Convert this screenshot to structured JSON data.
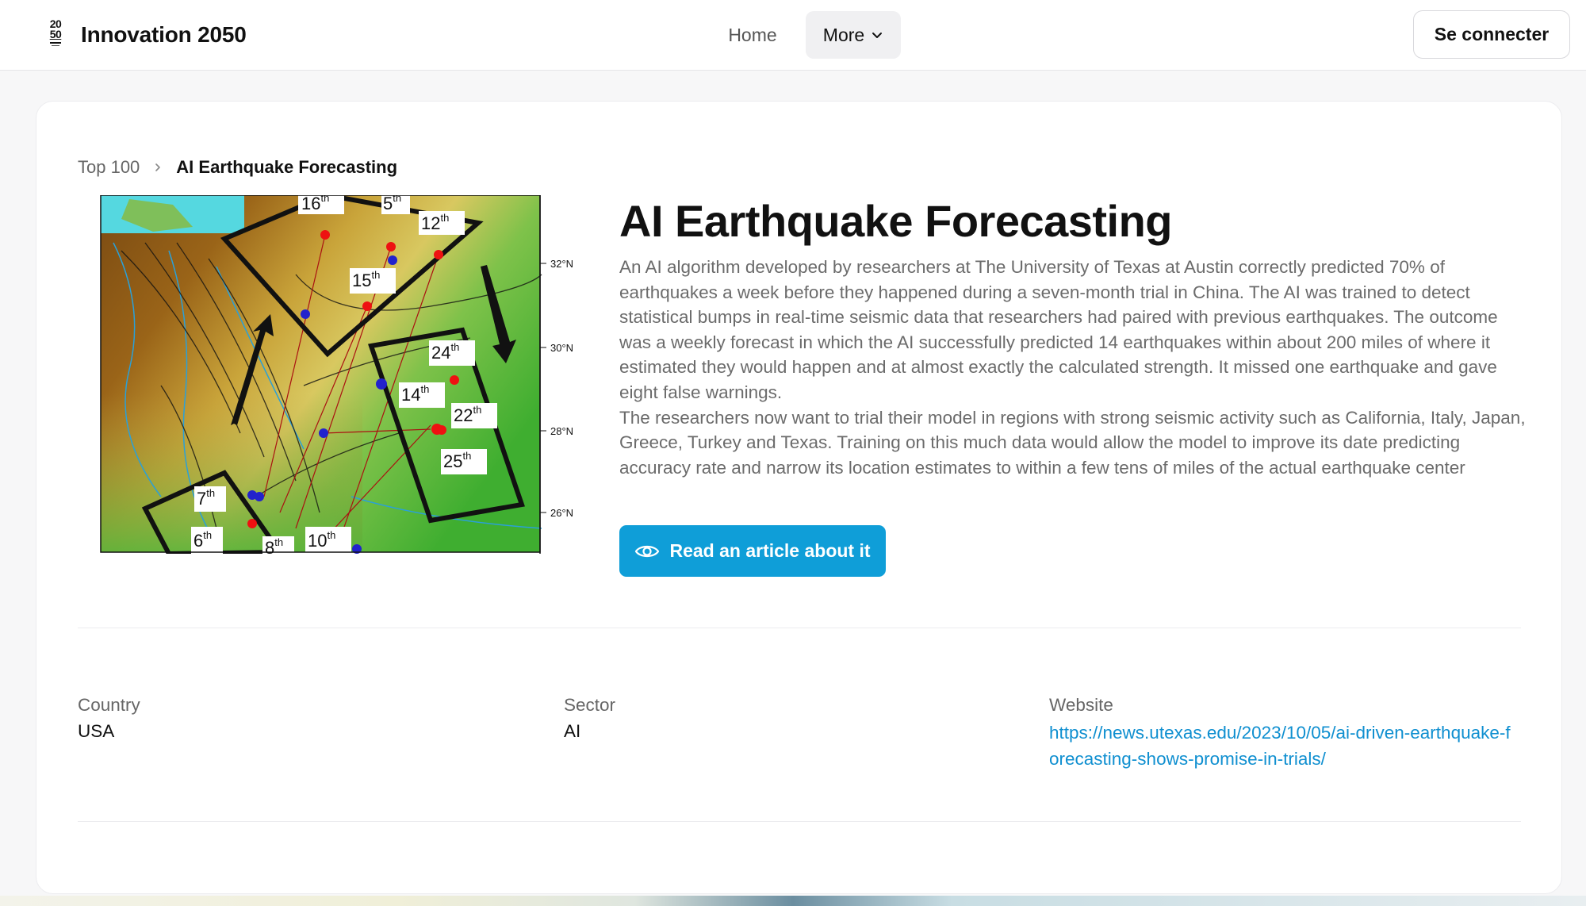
{
  "header": {
    "logo_top": "20",
    "logo_bottom": "50",
    "brand": "Innovation 2050",
    "nav_home": "Home",
    "nav_more": "More",
    "signin": "Se connecter"
  },
  "breadcrumb": {
    "parent": "Top 100",
    "current": "AI Earthquake Forecasting"
  },
  "article": {
    "title": "AI Earthquake Forecasting",
    "paragraph1": "An AI algorithm developed by researchers at The University of Texas at Austin correctly predicted 70% of earthquakes a week before they happened during a seven-month trial in China. The AI was trained to detect statistical bumps in real-time seismic data that researchers had paired with previous earthquakes. The outcome was a weekly forecast in which the AI successfully predicted 14 earthquakes within about 200 miles of where it estimated they would happen and at almost exactly the calculated strength. It missed one earthquake and gave eight false warnings.",
    "paragraph2": "The researchers now want to trial their model in regions with strong seismic activity such as California, Italy, Japan, Greece, Turkey and Texas. Training on this much data would allow the model to improve its date predicting accuracy rate and narrow its location estimates to within a few tens of miles of the actual earthquake center",
    "read_button": "Read an article about it"
  },
  "map": {
    "lat_labels": [
      "32°N",
      "30°N",
      "28°N",
      "26°N"
    ],
    "labels": [
      {
        "n": "16",
        "sup": "th"
      },
      {
        "n": "5",
        "sup": "th"
      },
      {
        "n": "12",
        "sup": "th"
      },
      {
        "n": "15",
        "sup": "th"
      },
      {
        "n": "24",
        "sup": "th"
      },
      {
        "n": "14",
        "sup": "th"
      },
      {
        "n": "22",
        "sup": "th"
      },
      {
        "n": "25",
        "sup": "th"
      },
      {
        "n": "7",
        "sup": "th"
      },
      {
        "n": "6",
        "sup": "th"
      },
      {
        "n": "8",
        "sup": "th"
      },
      {
        "n": "10",
        "sup": "th"
      }
    ]
  },
  "meta": {
    "country_label": "Country",
    "country_value": "USA",
    "sector_label": "Sector",
    "sector_value": "AI",
    "website_label": "Website",
    "website_value": "https://news.utexas.edu/2023/10/05/ai-driven-earthquake-forecasting-shows-promise-in-trials/"
  },
  "colors": {
    "accent": "#0f9ed8",
    "link": "#0f8fd0"
  }
}
